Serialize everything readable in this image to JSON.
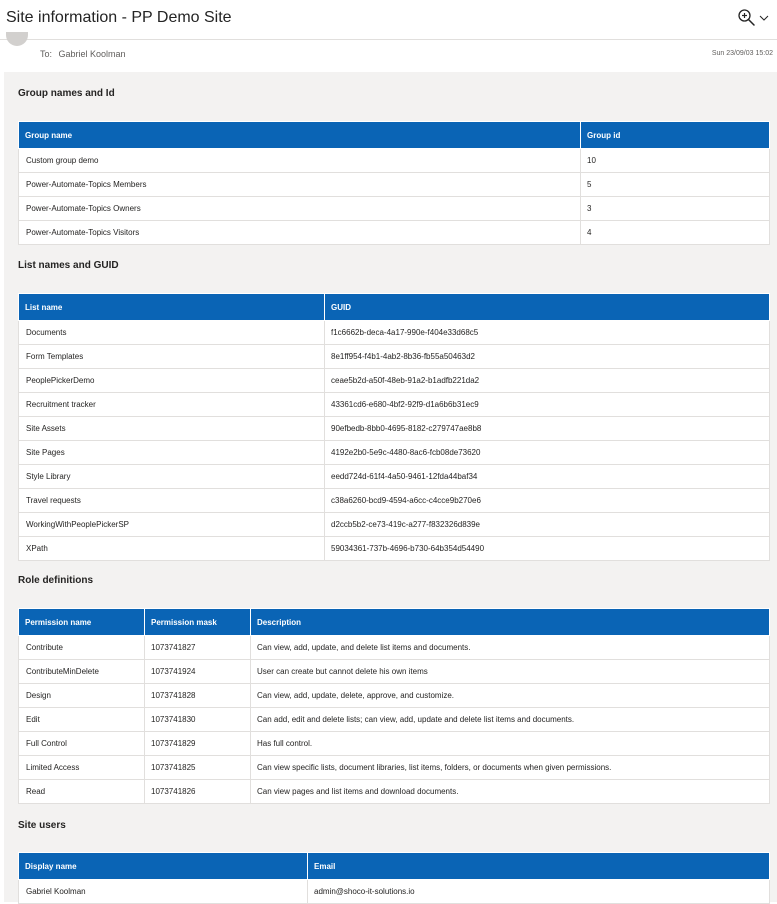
{
  "header": {
    "subject": "Site information - PP Demo Site",
    "zoom_icon": "zoom-in-icon",
    "dropdown_icon": "chevron-down-icon"
  },
  "message": {
    "to_label": "To:",
    "recipient": "Gabriel Koolman",
    "date": "Sun 23/09/03 15:02"
  },
  "colors": {
    "header_blue": "#0a64b5",
    "body_background": "#f3f2f1"
  },
  "groups": {
    "title": "Group names and Id",
    "columns": [
      "Group name",
      "Group id"
    ],
    "rows": [
      [
        "Custom group demo",
        "10"
      ],
      [
        "Power-Automate-Topics Members",
        "5"
      ],
      [
        "Power-Automate-Topics Owners",
        "3"
      ],
      [
        "Power-Automate-Topics Visitors",
        "4"
      ]
    ]
  },
  "lists": {
    "title": "List names and GUID",
    "columns": [
      "List name",
      "GUID"
    ],
    "rows": [
      [
        "Documents",
        "f1c6662b-deca-4a17-990e-f404e33d68c5"
      ],
      [
        "Form Templates",
        "8e1ff954-f4b1-4ab2-8b36-fb55a50463d2"
      ],
      [
        "PeoplePickerDemo",
        "ceae5b2d-a50f-48eb-91a2-b1adfb221da2"
      ],
      [
        "Recruitment tracker",
        "43361cd6-e680-4bf2-92f9-d1a6b6b31ec9"
      ],
      [
        "Site Assets",
        "90efbedb-8bb0-4695-8182-c279747ae8b8"
      ],
      [
        "Site Pages",
        "4192e2b0-5e9c-4480-8ac6-fcb08de73620"
      ],
      [
        "Style Library",
        "eedd724d-61f4-4a50-9461-12fda44baf34"
      ],
      [
        "Travel requests",
        "c38a6260-bcd9-4594-a6cc-c4cce9b270e6"
      ],
      [
        "WorkingWithPeoplePickerSP",
        "d2ccb5b2-ce73-419c-a277-f832326d839e"
      ],
      [
        "XPath",
        "59034361-737b-4696-b730-64b354d54490"
      ]
    ]
  },
  "roles": {
    "title": "Role definitions",
    "columns": [
      "Permission name",
      "Permission mask",
      "Description"
    ],
    "rows": [
      [
        "Contribute",
        "1073741827",
        "Can view, add, update, and delete list items and documents."
      ],
      [
        "ContributeMinDelete",
        "1073741924",
        "User can create but cannot delete his own items"
      ],
      [
        "Design",
        "1073741828",
        "Can view, add, update, delete, approve, and customize."
      ],
      [
        "Edit",
        "1073741830",
        "Can add, edit and delete lists; can view, add, update and delete list items and documents."
      ],
      [
        "Full Control",
        "1073741829",
        "Has full control."
      ],
      [
        "Limited Access",
        "1073741825",
        "Can view specific lists, document libraries, list items, folders, or documents when given permissions."
      ],
      [
        "Read",
        "1073741826",
        "Can view pages and list items and download documents."
      ]
    ]
  },
  "users": {
    "title": "Site users",
    "columns": [
      "Display name",
      "Email"
    ],
    "rows": [
      [
        "Gabriel Koolman",
        "admin@shoco-it-solutions.io"
      ]
    ]
  }
}
